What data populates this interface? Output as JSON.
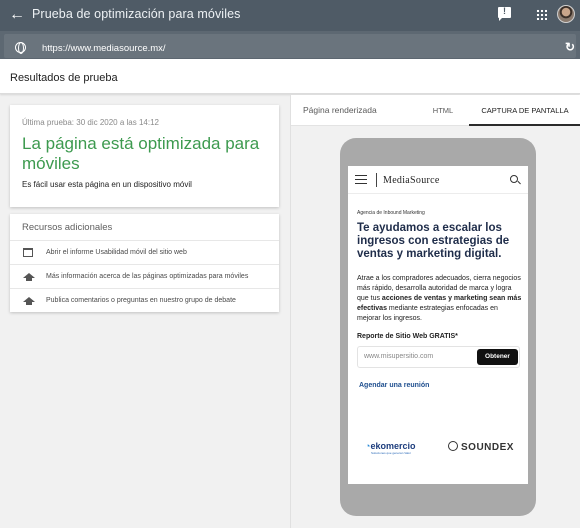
{
  "topbar": {
    "title": "Prueba de optimización para móviles",
    "icons": [
      "back-arrow-icon",
      "feedback-icon",
      "apps-grid-icon",
      "avatar"
    ]
  },
  "urlbar": {
    "url": "https://www.mediasource.mx/",
    "icons": [
      "globe-icon",
      "reload-icon"
    ]
  },
  "results": {
    "title": "Resultados de prueba"
  },
  "verdict": {
    "date": "Última prueba: 30 dic 2020 a las 14:12",
    "headline": "La página está optimizada para móviles",
    "sub": "Es fácil usar esta página en un dispositivo móvil",
    "headline_color": "#3d9a4f"
  },
  "resources": {
    "heading": "Recursos adicionales",
    "items": [
      {
        "label": "Abrir el informe Usabilidad móvil del sitio web",
        "icon": "report-icon"
      },
      {
        "label": "Más información acerca de las páginas optimizadas para móviles",
        "icon": "school-icon"
      },
      {
        "label": "Publica comentarios o preguntas en nuestro grupo de debate",
        "icon": "school-icon"
      }
    ]
  },
  "tabs": {
    "rendered": "Página renderizada",
    "html": "HTML",
    "capture": "CAPTURA DE PANTALLA",
    "active": "capture"
  },
  "screenshot": {
    "logo": "MediaSource",
    "kicker": "Agencia de Inbound Marketing",
    "hero": "Te ayudamos a escalar los ingresos con estrategias de ventas y marketing digital.",
    "body_1": "Atrae a los compradores adecuados, cierra negocios más rápido, desarrolla autoridad de marca y logra que tus ",
    "body_bold": "acciones de ventas y marketing sean más efectivas",
    "body_2": " mediante estrategias enfocadas en mejorar los ingresos.",
    "report_label": "Reporte de Sitio Web GRATIS*",
    "input_placeholder": "www.misupersitio.com",
    "button": "Obtener",
    "meeting_link": "Agendar una reunión",
    "partner_1": "ekomercio",
    "partner_1_tag": "Soluciones que generan Valor",
    "partner_2": "SOUNDEX"
  }
}
